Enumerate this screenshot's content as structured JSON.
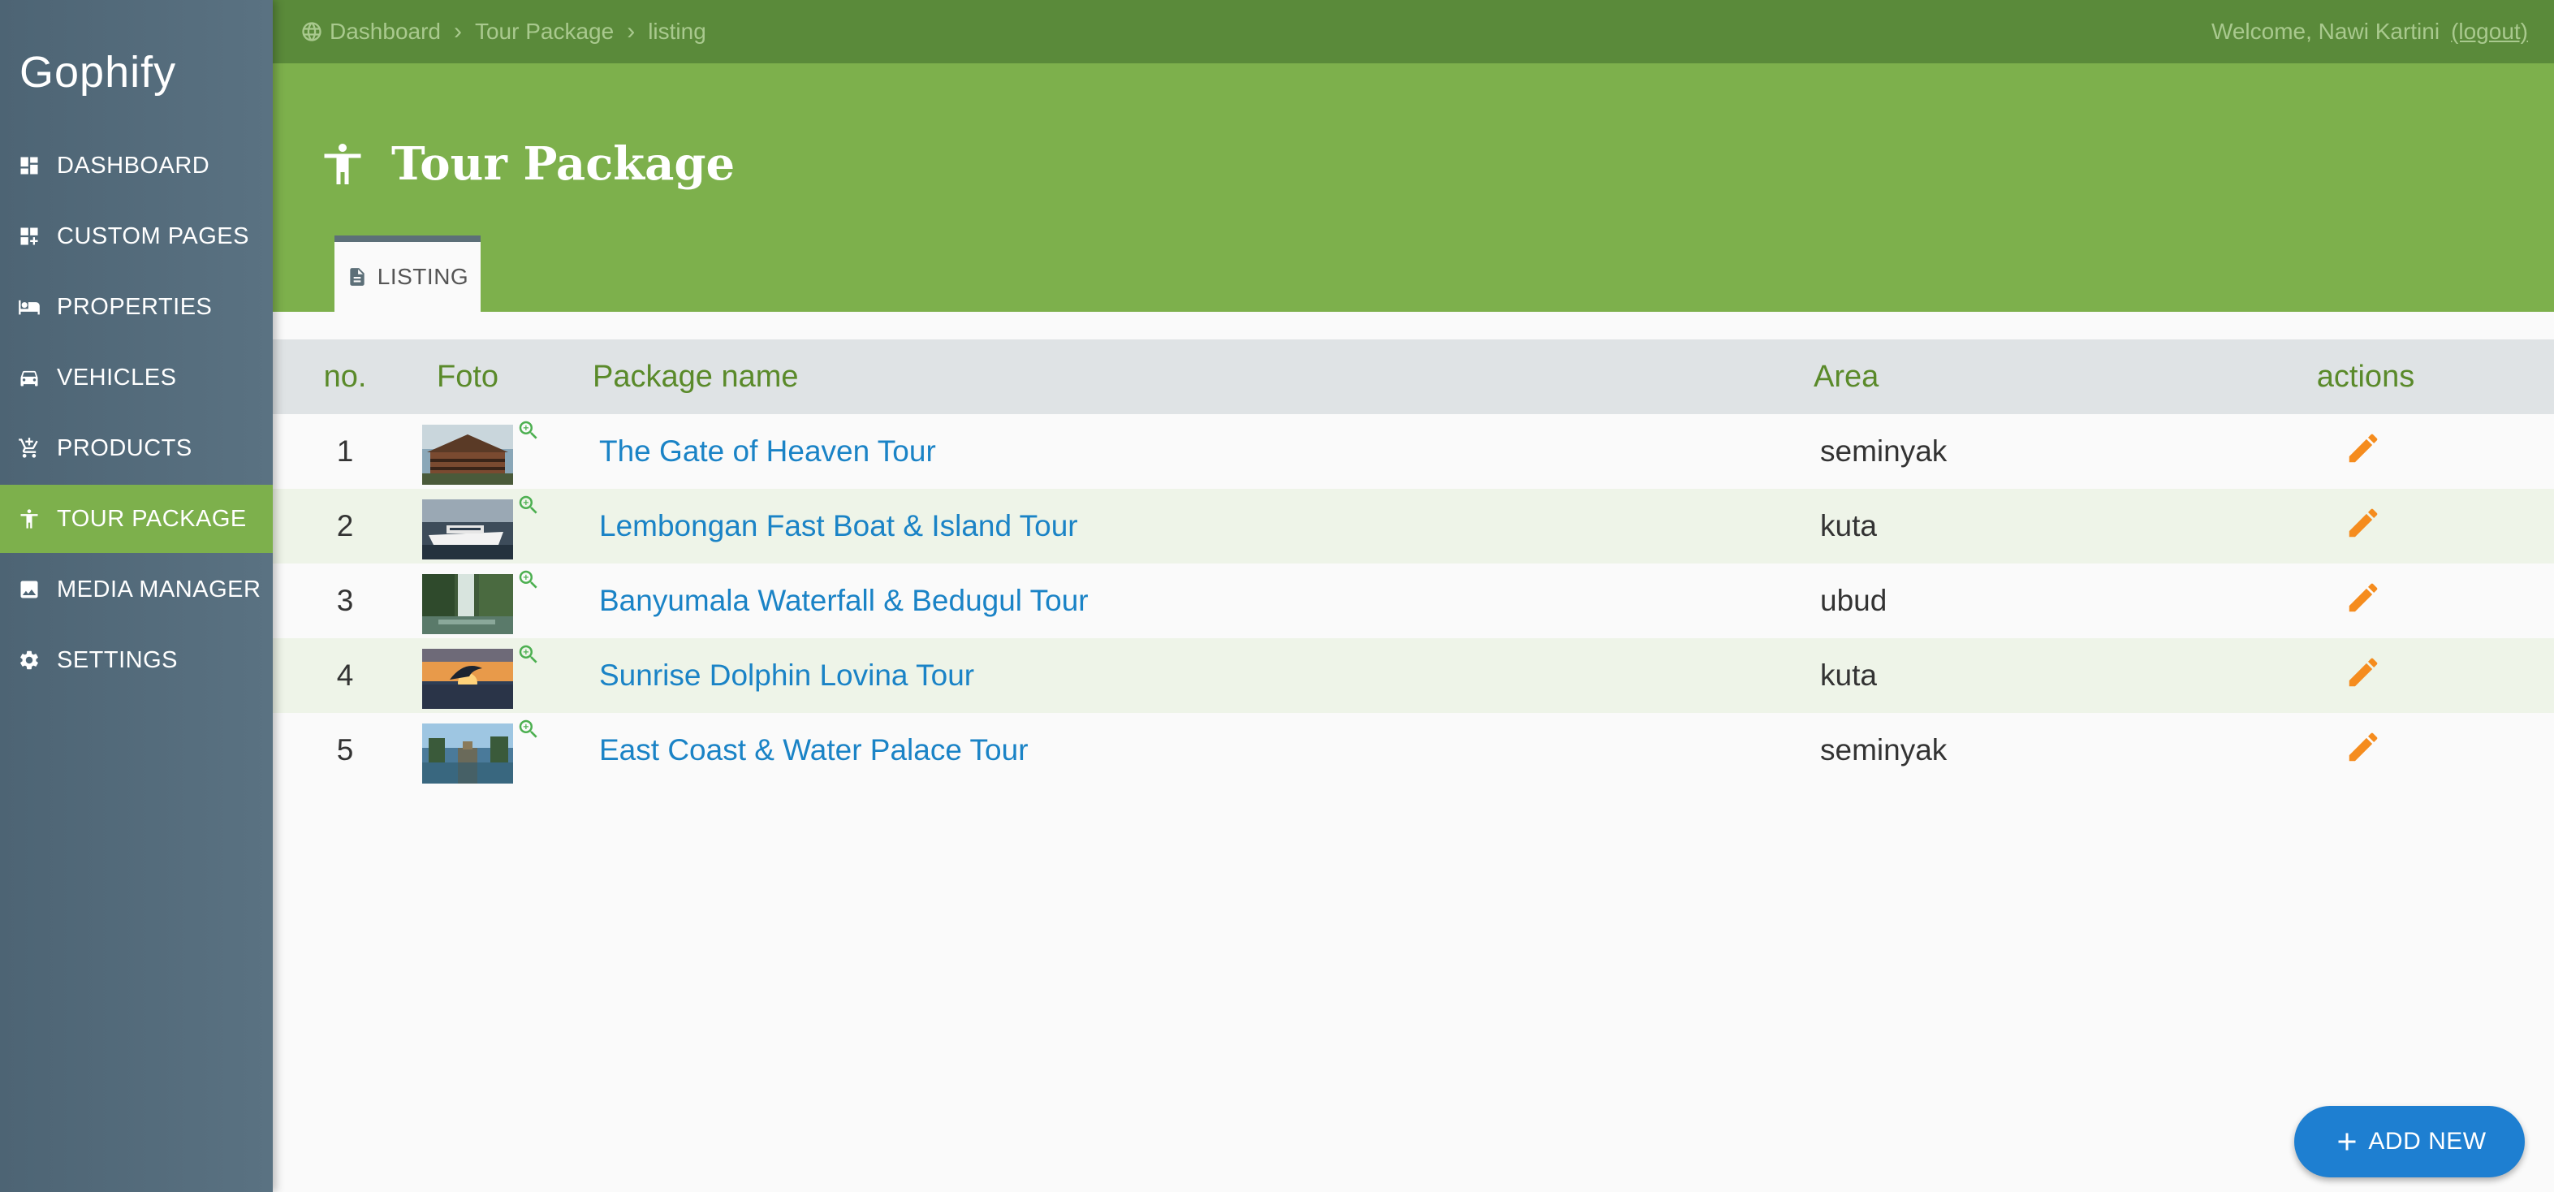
{
  "brand": "Gophify",
  "sidebar": {
    "items": [
      {
        "label": "DASHBOARD",
        "icon": "dashboard-icon"
      },
      {
        "label": "CUSTOM PAGES",
        "icon": "custom-pages-icon"
      },
      {
        "label": "PROPERTIES",
        "icon": "bed-icon"
      },
      {
        "label": "VEHICLES",
        "icon": "car-icon"
      },
      {
        "label": "PRODUCTS",
        "icon": "cart-icon"
      },
      {
        "label": "TOUR PACKAGE",
        "icon": "accessibility-person-icon",
        "active": true
      },
      {
        "label": "MEDIA MANAGER",
        "icon": "image-icon"
      },
      {
        "label": "SETTINGS",
        "icon": "gear-icon"
      }
    ]
  },
  "topbar": {
    "breadcrumb": [
      "Dashboard",
      "Tour Package",
      "listing"
    ],
    "welcome": "Welcome, Nawi Kartini",
    "logout": "(logout)"
  },
  "header": {
    "title": "Tour Package",
    "tab_label": "LISTING"
  },
  "table": {
    "columns": [
      "no.",
      "Foto",
      "Package name",
      "Area",
      "actions"
    ],
    "rows": [
      {
        "no": "1",
        "name": "The Gate of Heaven Tour",
        "area": "seminyak",
        "thumb": "temple"
      },
      {
        "no": "2",
        "name": "Lembongan Fast Boat & Island Tour",
        "area": "kuta",
        "thumb": "boat"
      },
      {
        "no": "3",
        "name": "Banyumala Waterfall & Bedugul Tour",
        "area": "ubud",
        "thumb": "waterfall"
      },
      {
        "no": "4",
        "name": "Sunrise Dolphin Lovina Tour",
        "area": "kuta",
        "thumb": "dolphin"
      },
      {
        "no": "5",
        "name": "East Coast & Water Palace Tour",
        "area": "seminyak",
        "thumb": "palace"
      }
    ]
  },
  "add_button": "ADD NEW",
  "colors": {
    "sidebar": "#52697a",
    "accent_green": "#7db04c",
    "topbar_green": "#5a8a3a",
    "link_blue": "#1a83c6",
    "edit_orange": "#f58c1e",
    "fab_blue": "#1e7fd1"
  }
}
